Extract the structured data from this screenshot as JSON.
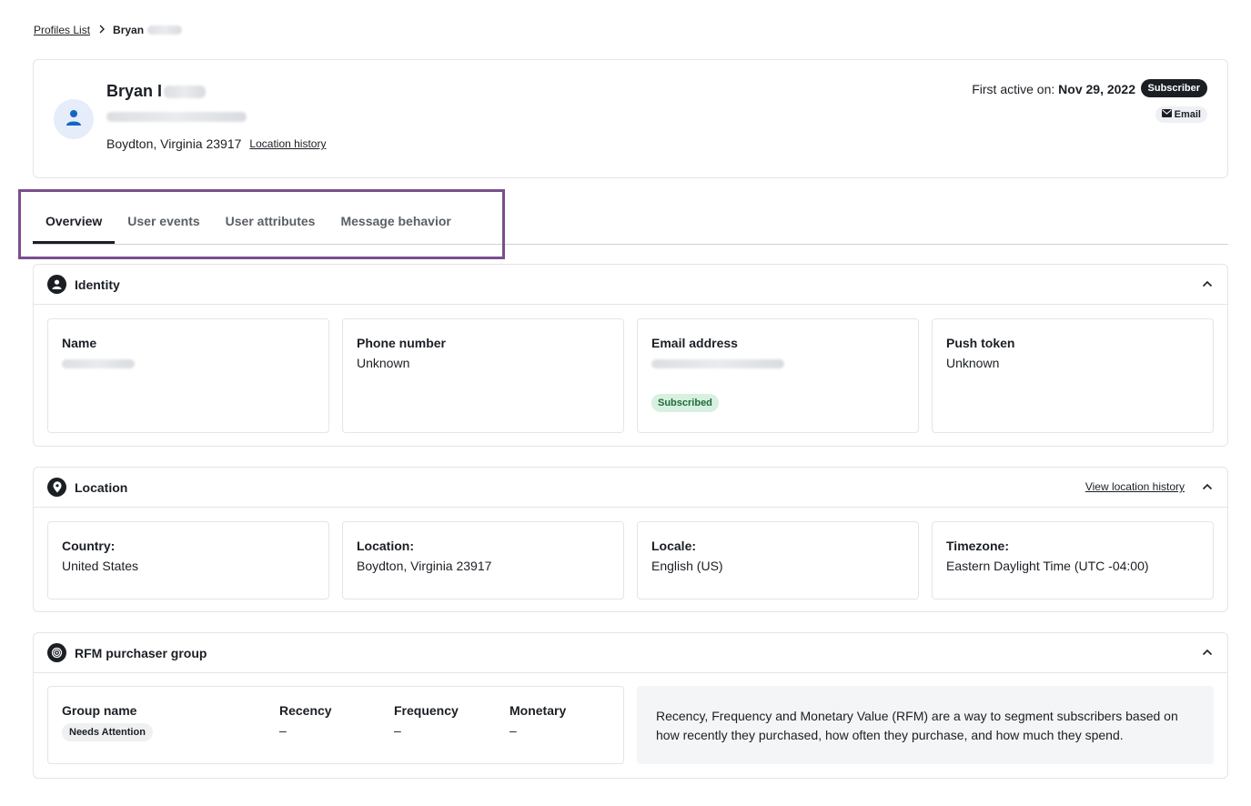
{
  "breadcrumb": {
    "parent": "Profiles List",
    "separator": ">",
    "current": "Bryan"
  },
  "profile": {
    "name_first": "Bryan I",
    "location": "Boydton, Virginia 23917",
    "location_history_link": "Location history",
    "first_active_label": "First active on:",
    "first_active_date": "Nov 29, 2022",
    "status_badge": "Subscriber",
    "channel_badge": "Email"
  },
  "tabs": [
    {
      "label": "Overview",
      "active": true
    },
    {
      "label": "User events",
      "active": false
    },
    {
      "label": "User attributes",
      "active": false
    },
    {
      "label": "Message behavior",
      "active": false
    }
  ],
  "identity": {
    "title": "Identity",
    "name_label": "Name",
    "phone_label": "Phone number",
    "phone_value": "Unknown",
    "email_label": "Email address",
    "email_status": "Subscribed",
    "push_label": "Push token",
    "push_value": "Unknown"
  },
  "location": {
    "title": "Location",
    "view_link": "View location history",
    "country_label": "Country:",
    "country_value": "United States",
    "location_label": "Location:",
    "location_value": "Boydton, Virginia 23917",
    "locale_label": "Locale:",
    "locale_value": "English (US)",
    "timezone_label": "Timezone:",
    "timezone_value": "Eastern Daylight Time (UTC -04:00)"
  },
  "rfm": {
    "title": "RFM purchaser group",
    "group_label": "Group name",
    "group_value": "Needs Attention",
    "recency_label": "Recency",
    "recency_value": "–",
    "frequency_label": "Frequency",
    "frequency_value": "–",
    "monetary_label": "Monetary",
    "monetary_value": "–",
    "description": "Recency, Frequency and Monetary Value (RFM) are a way to segment subscribers based on how recently they purchased, how often they purchase, and how much they spend."
  },
  "colors": {
    "accent_highlight": "#7b4e8e",
    "dark": "#1b1f24",
    "success_bg": "#d7f0df",
    "avatar_bg": "#e4edf9",
    "avatar_icon": "#1565c0"
  },
  "icons": [
    "chevron-right-icon",
    "user-icon",
    "envelope-icon",
    "identity-icon",
    "location-pin-icon",
    "target-icon",
    "chevron-up-icon"
  ]
}
